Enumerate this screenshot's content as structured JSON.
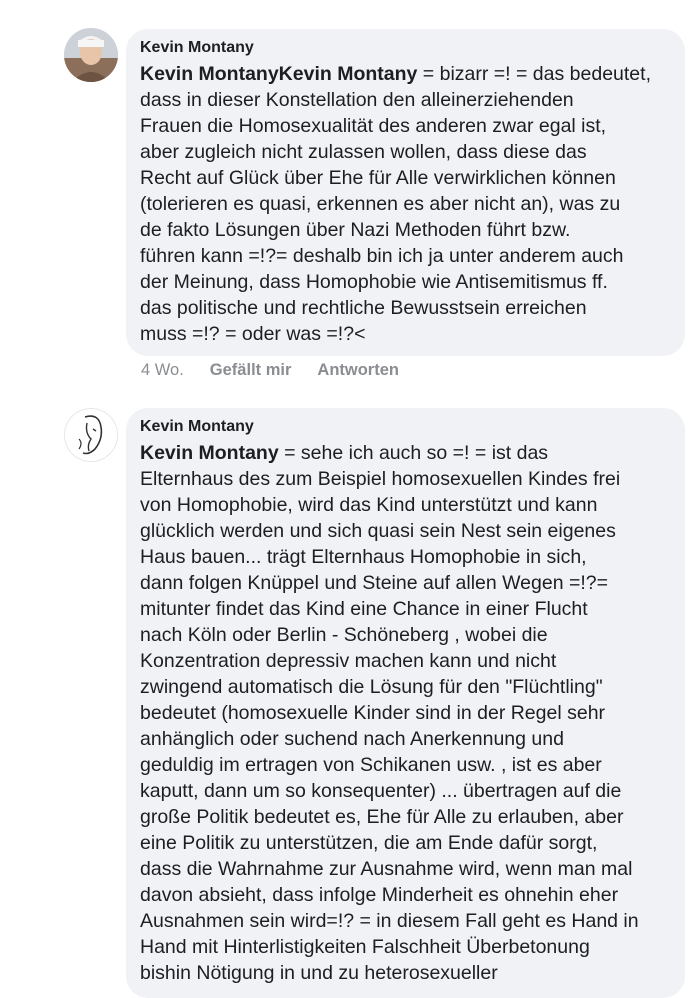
{
  "comments": [
    {
      "author": "Kevin Montany",
      "mention": "Kevin MontanyKevin Montany",
      "text": " = bizarr =! = das bedeutet,\ndass in dieser Konstellation den alleinerziehenden\nFrauen die Homosexualität des anderen zwar egal ist,\naber zugleich nicht zulassen wollen, dass diese das\nRecht auf Glück über Ehe für Alle verwirklichen können\n(tolerieren es quasi, erkennen es aber nicht an), was zu\nde fakto Lösungen über Nazi Methoden führt bzw.\nführen kann =!?= deshalb bin ich ja unter anderem auch\nder Meinung, dass Homophobie wie Antisemitismus ff.\ndas politische und rechtliche Bewusstsein erreichen\nmuss =!? = oder was =!?<",
      "time": "4 Wo.",
      "like_label": "Gefällt mir",
      "reply_label": "Antworten"
    },
    {
      "author": "Kevin Montany",
      "mention": "Kevin Montany",
      "text": " = sehe ich auch so =! = ist das\nElternhaus des zum Beispiel homosexuellen Kindes frei\nvon Homophobie, wird das Kind unterstützt und kann\nglücklich werden und sich quasi sein Nest sein eigenes\nHaus bauen... trägt Elternhaus Homophobie in sich,\ndann folgen Knüppel und Steine auf allen Wegen =!?=\nmitunter findet das Kind eine Chance in einer Flucht\nnach Köln oder Berlin - Schöneberg , wobei die\nKonzentration depressiv machen kann und nicht\nzwingend automatisch die Lösung für den \"Flüchtling\"\nbedeutet (homosexuelle Kinder sind in der Regel sehr\nanhänglich oder suchend nach Anerkennung und\ngeduldig im ertragen von Schikanen usw. , ist es aber\nkaputt, dann um so konsequenter) ... übertragen auf die\ngroße Politik bedeutet es, Ehe für Alle zu erlauben, aber\neine Politik zu unterstützen, die am Ende dafür sorgt,\ndass die Wahrnahme zur Ausnahme wird, wenn man mal\ndavon absieht, dass infolge Minderheit es ohnehin eher\nAusnahmen sein wird=!? = in diesem Fall geht es Hand in\nHand mit Hinterlistigkeiten Falschheit Überbetonung\nbishin Nötigung in und zu heterosexueller"
    }
  ]
}
